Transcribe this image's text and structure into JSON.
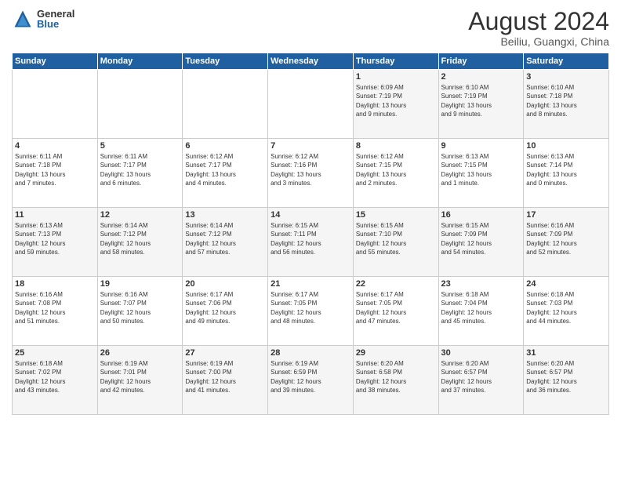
{
  "logo": {
    "general": "General",
    "blue": "Blue"
  },
  "title": "August 2024",
  "subtitle": "Beiliu, Guangxi, China",
  "days_of_week": [
    "Sunday",
    "Monday",
    "Tuesday",
    "Wednesday",
    "Thursday",
    "Friday",
    "Saturday"
  ],
  "weeks": [
    [
      {
        "num": "",
        "detail": ""
      },
      {
        "num": "",
        "detail": ""
      },
      {
        "num": "",
        "detail": ""
      },
      {
        "num": "",
        "detail": ""
      },
      {
        "num": "1",
        "detail": "Sunrise: 6:09 AM\nSunset: 7:19 PM\nDaylight: 13 hours\nand 9 minutes."
      },
      {
        "num": "2",
        "detail": "Sunrise: 6:10 AM\nSunset: 7:19 PM\nDaylight: 13 hours\nand 9 minutes."
      },
      {
        "num": "3",
        "detail": "Sunrise: 6:10 AM\nSunset: 7:18 PM\nDaylight: 13 hours\nand 8 minutes."
      }
    ],
    [
      {
        "num": "4",
        "detail": "Sunrise: 6:11 AM\nSunset: 7:18 PM\nDaylight: 13 hours\nand 7 minutes."
      },
      {
        "num": "5",
        "detail": "Sunrise: 6:11 AM\nSunset: 7:17 PM\nDaylight: 13 hours\nand 6 minutes."
      },
      {
        "num": "6",
        "detail": "Sunrise: 6:12 AM\nSunset: 7:17 PM\nDaylight: 13 hours\nand 4 minutes."
      },
      {
        "num": "7",
        "detail": "Sunrise: 6:12 AM\nSunset: 7:16 PM\nDaylight: 13 hours\nand 3 minutes."
      },
      {
        "num": "8",
        "detail": "Sunrise: 6:12 AM\nSunset: 7:15 PM\nDaylight: 13 hours\nand 2 minutes."
      },
      {
        "num": "9",
        "detail": "Sunrise: 6:13 AM\nSunset: 7:15 PM\nDaylight: 13 hours\nand 1 minute."
      },
      {
        "num": "10",
        "detail": "Sunrise: 6:13 AM\nSunset: 7:14 PM\nDaylight: 13 hours\nand 0 minutes."
      }
    ],
    [
      {
        "num": "11",
        "detail": "Sunrise: 6:13 AM\nSunset: 7:13 PM\nDaylight: 12 hours\nand 59 minutes."
      },
      {
        "num": "12",
        "detail": "Sunrise: 6:14 AM\nSunset: 7:12 PM\nDaylight: 12 hours\nand 58 minutes."
      },
      {
        "num": "13",
        "detail": "Sunrise: 6:14 AM\nSunset: 7:12 PM\nDaylight: 12 hours\nand 57 minutes."
      },
      {
        "num": "14",
        "detail": "Sunrise: 6:15 AM\nSunset: 7:11 PM\nDaylight: 12 hours\nand 56 minutes."
      },
      {
        "num": "15",
        "detail": "Sunrise: 6:15 AM\nSunset: 7:10 PM\nDaylight: 12 hours\nand 55 minutes."
      },
      {
        "num": "16",
        "detail": "Sunrise: 6:15 AM\nSunset: 7:09 PM\nDaylight: 12 hours\nand 54 minutes."
      },
      {
        "num": "17",
        "detail": "Sunrise: 6:16 AM\nSunset: 7:09 PM\nDaylight: 12 hours\nand 52 minutes."
      }
    ],
    [
      {
        "num": "18",
        "detail": "Sunrise: 6:16 AM\nSunset: 7:08 PM\nDaylight: 12 hours\nand 51 minutes."
      },
      {
        "num": "19",
        "detail": "Sunrise: 6:16 AM\nSunset: 7:07 PM\nDaylight: 12 hours\nand 50 minutes."
      },
      {
        "num": "20",
        "detail": "Sunrise: 6:17 AM\nSunset: 7:06 PM\nDaylight: 12 hours\nand 49 minutes."
      },
      {
        "num": "21",
        "detail": "Sunrise: 6:17 AM\nSunset: 7:05 PM\nDaylight: 12 hours\nand 48 minutes."
      },
      {
        "num": "22",
        "detail": "Sunrise: 6:17 AM\nSunset: 7:05 PM\nDaylight: 12 hours\nand 47 minutes."
      },
      {
        "num": "23",
        "detail": "Sunrise: 6:18 AM\nSunset: 7:04 PM\nDaylight: 12 hours\nand 45 minutes."
      },
      {
        "num": "24",
        "detail": "Sunrise: 6:18 AM\nSunset: 7:03 PM\nDaylight: 12 hours\nand 44 minutes."
      }
    ],
    [
      {
        "num": "25",
        "detail": "Sunrise: 6:18 AM\nSunset: 7:02 PM\nDaylight: 12 hours\nand 43 minutes."
      },
      {
        "num": "26",
        "detail": "Sunrise: 6:19 AM\nSunset: 7:01 PM\nDaylight: 12 hours\nand 42 minutes."
      },
      {
        "num": "27",
        "detail": "Sunrise: 6:19 AM\nSunset: 7:00 PM\nDaylight: 12 hours\nand 41 minutes."
      },
      {
        "num": "28",
        "detail": "Sunrise: 6:19 AM\nSunset: 6:59 PM\nDaylight: 12 hours\nand 39 minutes."
      },
      {
        "num": "29",
        "detail": "Sunrise: 6:20 AM\nSunset: 6:58 PM\nDaylight: 12 hours\nand 38 minutes."
      },
      {
        "num": "30",
        "detail": "Sunrise: 6:20 AM\nSunset: 6:57 PM\nDaylight: 12 hours\nand 37 minutes."
      },
      {
        "num": "31",
        "detail": "Sunrise: 6:20 AM\nSunset: 6:57 PM\nDaylight: 12 hours\nand 36 minutes."
      }
    ]
  ]
}
